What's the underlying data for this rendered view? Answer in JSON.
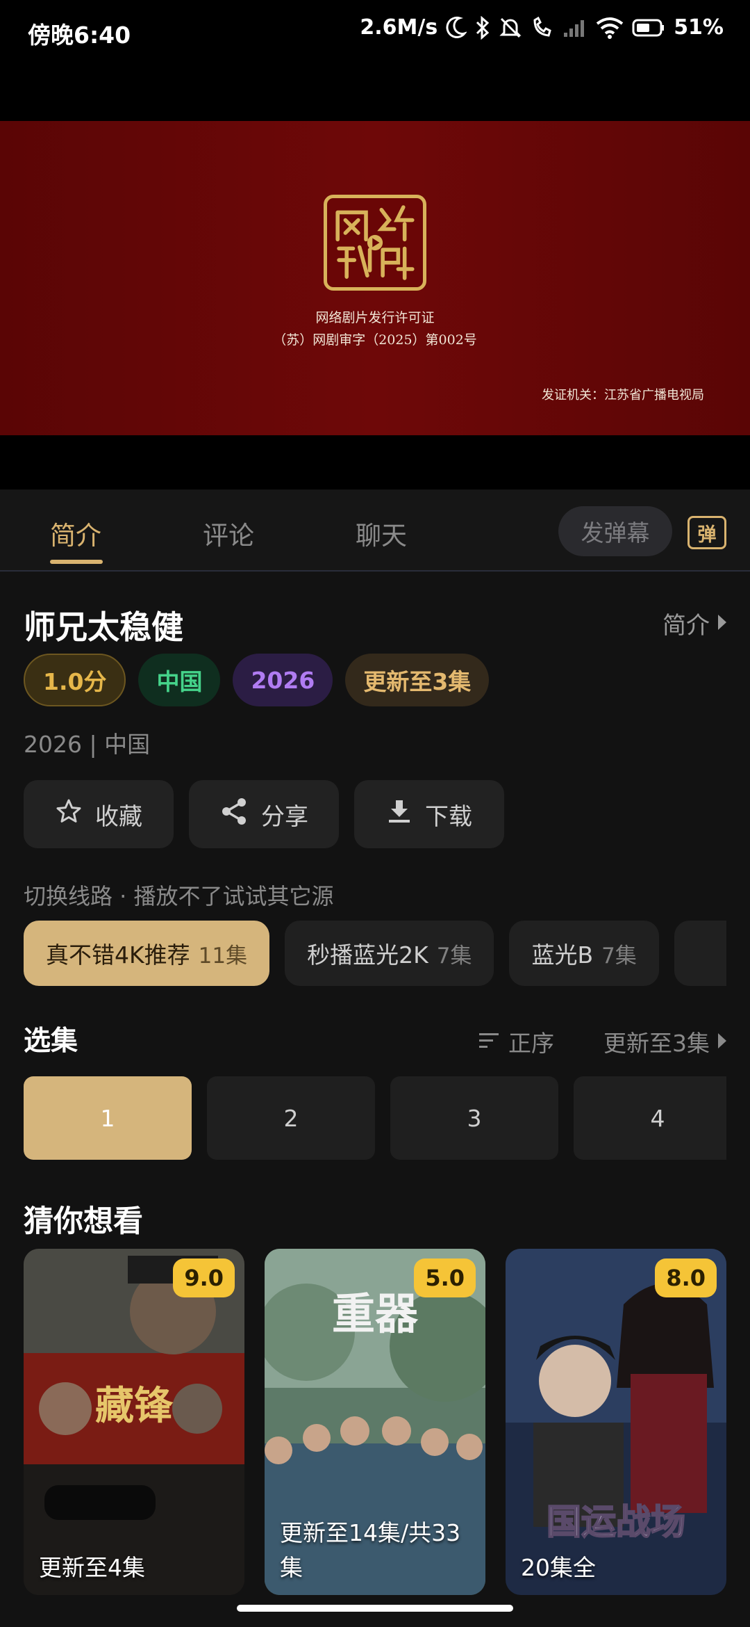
{
  "status_bar": {
    "time": "傍晚6:40",
    "network_speed": "2.6M/s",
    "battery": "51%",
    "icons": [
      "moon-icon",
      "bluetooth-icon",
      "bell-off-icon",
      "call-icon",
      "signal-icon",
      "wifi-icon",
      "battery-icon"
    ]
  },
  "player": {
    "seal_text": "网络视听",
    "license_title": "网络剧片发行许可证",
    "license_number": "（苏）网剧审字（2025）第002号",
    "issuer": "发证机关：江苏省广播电视局"
  },
  "tabs": [
    {
      "label": "简介",
      "active": true
    },
    {
      "label": "评论",
      "active": false
    },
    {
      "label": "聊天",
      "active": false
    }
  ],
  "danmaku": {
    "placeholder": "发弹幕",
    "toggle_label": "弹"
  },
  "show": {
    "title": "师兄太稳健",
    "intro_link": "简介",
    "tags": {
      "score": "1.0分",
      "region": "中国",
      "year": "2026",
      "update": "更新至3集"
    },
    "meta": "2026 | 中国"
  },
  "actions": {
    "favorite": "收藏",
    "share": "分享",
    "download": "下载"
  },
  "routes": {
    "hint": "切换线路 · 播放不了试试其它源",
    "items": [
      {
        "name": "真不错4K推荐",
        "count": "11集",
        "active": true
      },
      {
        "name": "秒播蓝光2K",
        "count": "7集",
        "active": false
      },
      {
        "name": "蓝光B",
        "count": "7集",
        "active": false
      },
      {
        "name": "",
        "count": "",
        "active": false
      }
    ]
  },
  "episodes": {
    "heading": "选集",
    "sort_label": "正序",
    "update_label": "更新至3集",
    "items": [
      "1",
      "2",
      "3",
      "4"
    ],
    "selected": "1"
  },
  "recommendations": {
    "heading": "猜你想看",
    "items": [
      {
        "score": "9.0",
        "caption": "更新至4集",
        "poster_title": "藏锋"
      },
      {
        "score": "5.0",
        "caption": "更新至14集/共33集",
        "poster_title": "重器"
      },
      {
        "score": "8.0",
        "caption": "20集全",
        "poster_title": "国运战场"
      }
    ]
  },
  "colors": {
    "accent": "#d9b36f",
    "background": "#121212",
    "score_badge": "#f5c437",
    "video_red": "#6e0808"
  }
}
